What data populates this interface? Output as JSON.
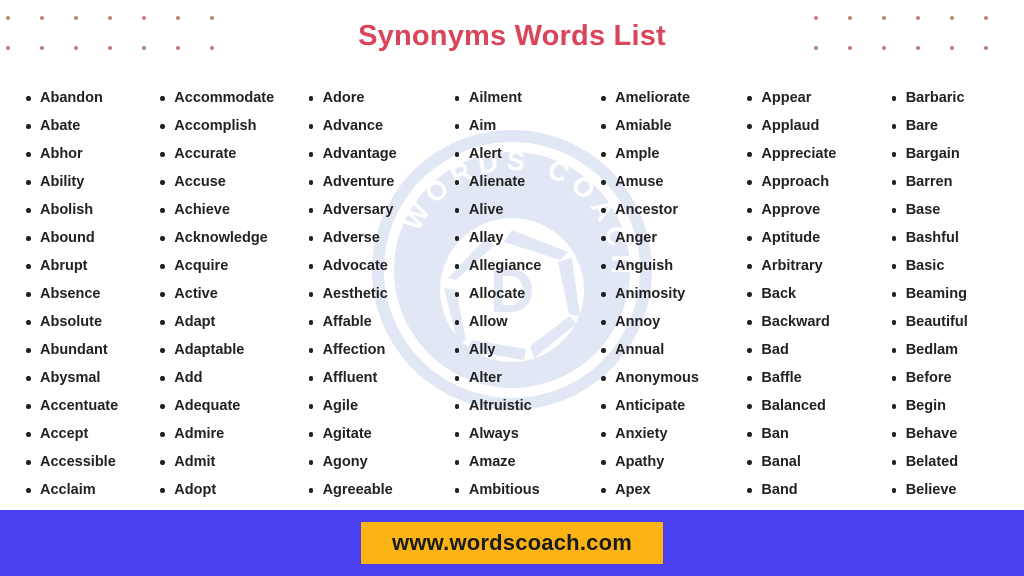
{
  "page": {
    "title": "Synonyms Words List",
    "title_color": "#d9455a",
    "background_color": "#ffffff"
  },
  "decor": {
    "dot_color": "#b5705f",
    "left_dot_grid": {
      "name": "dot-grid-left",
      "columns": 7,
      "rows": 2
    },
    "right_dot_grid": {
      "name": "dot-grid-right",
      "columns": 6,
      "rows": 2
    }
  },
  "watermark": {
    "text_top": "WORDS",
    "text_bottom": "COACH",
    "letter": "D",
    "color": "#e1e7f5"
  },
  "columns": [
    {
      "index": 1,
      "words": [
        "Abandon",
        "Abate",
        "Abhor",
        "Ability",
        "Abolish",
        "Abound",
        "Abrupt",
        "Absence",
        "Absolute",
        "Abundant",
        "Abysmal",
        "Accentuate",
        "Accept",
        "Accessible",
        "Acclaim"
      ]
    },
    {
      "index": 2,
      "words": [
        "Accommodate",
        "Accomplish",
        "Accurate",
        "Accuse",
        "Achieve",
        "Acknowledge",
        "Acquire",
        "Active",
        "Adapt",
        "Adaptable",
        "Add",
        "Adequate",
        "Admire",
        "Admit",
        "Adopt"
      ]
    },
    {
      "index": 3,
      "words": [
        "Adore",
        "Advance",
        "Advantage",
        "Adventure",
        "Adversary",
        "Adverse",
        "Advocate",
        "Aesthetic",
        "Affable",
        "Affection",
        "Affluent",
        "Agile",
        "Agitate",
        "Agony",
        "Agreeable"
      ]
    },
    {
      "index": 4,
      "words": [
        "Ailment",
        "Aim",
        "Alert",
        "Alienate",
        "Alive",
        "Allay",
        "Allegiance",
        "Allocate",
        "Allow",
        "Ally",
        "Alter",
        "Altruistic",
        "Always",
        "Amaze",
        "Ambitious"
      ]
    },
    {
      "index": 5,
      "words": [
        "Ameliorate",
        "Amiable",
        "Ample",
        "Amuse",
        "Ancestor",
        "Anger",
        "Anguish",
        "Animosity",
        "Annoy",
        "Annual",
        "Anonymous",
        "Anticipate",
        "Anxiety",
        "Apathy",
        "Apex"
      ]
    },
    {
      "index": 6,
      "words": [
        "Appear",
        "Applaud",
        "Appreciate",
        "Approach",
        "Approve",
        "Aptitude",
        "Arbitrary",
        "Back",
        "Backward",
        "Bad",
        "Baffle",
        "Balanced",
        "Ban",
        "Banal",
        "Band"
      ]
    },
    {
      "index": 7,
      "words": [
        "Barbaric",
        "Bare",
        "Bargain",
        "Barren",
        "Base",
        "Bashful",
        "Basic",
        "Beaming",
        "Beautiful",
        "Bedlam",
        "Before",
        "Begin",
        "Behave",
        "Belated",
        "Believe"
      ]
    }
  ],
  "footer": {
    "background_color": "#4b40f0",
    "badge_color": "#fcb415",
    "url": "www.wordscoach.com"
  }
}
